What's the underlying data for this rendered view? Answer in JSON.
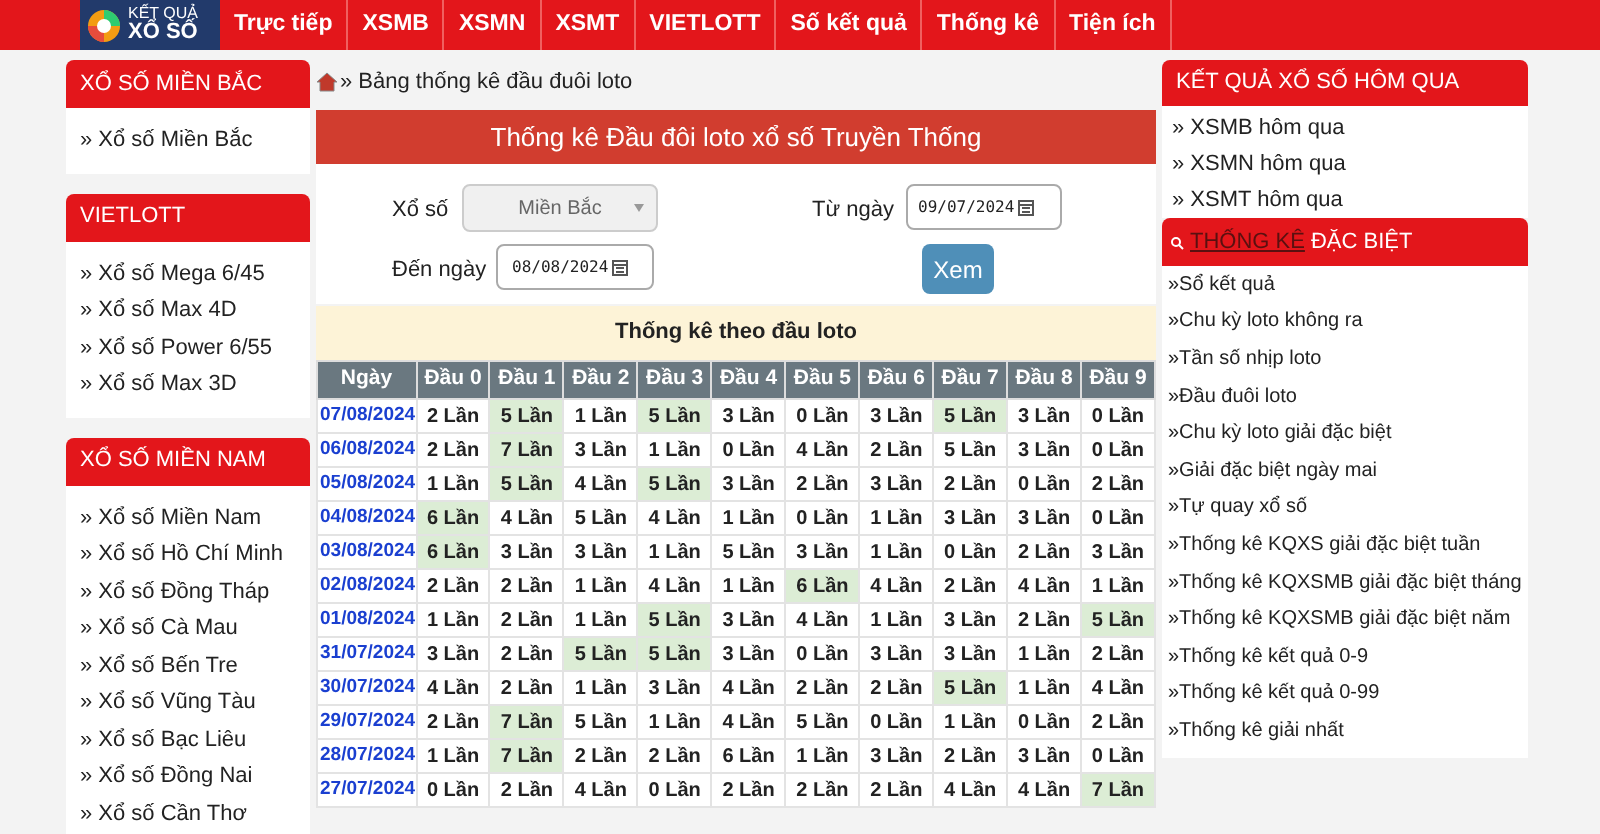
{
  "header": {
    "logo": {
      "line_1": "KẾT QUẢ",
      "line_2": "XỔ SỐ"
    },
    "nav": [
      "Trực tiếp",
      "XSMB",
      "XSMN",
      "XSMT",
      "VIETLOTT",
      "Số kết quả",
      "Thống kê",
      "Tiện ích"
    ]
  },
  "left_sidebar": [
    {
      "title": "XỔ SỐ MIỀN BẮC",
      "items": [
        "» Xổ số Miền Bắc"
      ]
    },
    {
      "title": "VIETLOTT",
      "items": [
        "» Xổ số Mega 6/45",
        "» Xổ số Max 4D",
        "» Xổ số Power 6/55",
        "» Xổ số Max 3D"
      ]
    },
    {
      "title": "XỔ SỐ MIỀN NAM",
      "items": [
        "» Xổ số Miền Nam",
        "» Xổ số Hồ Chí Minh",
        "» Xổ số Đồng Tháp",
        "» Xổ số Cà Mau",
        "» Xổ số Bến Tre",
        "» Xổ số Vũng Tàu",
        "» Xổ số Bạc Liêu",
        "» Xổ số Đồng Nai",
        "» Xổ số Cần Thơ"
      ]
    }
  ],
  "breadcrumb": "» Bảng thống kê đầu đuôi loto",
  "panel_title": "Thống kê Đầu đôi loto xổ số Truyền Thống",
  "form": {
    "lottery_label": "Xổ số",
    "lottery_value": "Miền Bắc",
    "from_label": "Từ ngày",
    "from_value": "09/07/2024",
    "to_label": "Đến ngày",
    "to_value": "08/08/2024",
    "submit": "Xem"
  },
  "table": {
    "caption": "Thống kê theo đầu loto",
    "date_column": "Ngày",
    "columns": [
      "Đầu 0",
      "Đầu 1",
      "Đầu 2",
      "Đầu 3",
      "Đầu 4",
      "Đầu 5",
      "Đầu 6",
      "Đầu 7",
      "Đầu 8",
      "Đầu 9"
    ],
    "rows": [
      {
        "date": "07/08/2024",
        "cells": [
          {
            "text": "2 Lần",
            "highlighted": false
          },
          {
            "text": "5 Lần",
            "highlighted": true
          },
          {
            "text": "1 Lần",
            "highlighted": false
          },
          {
            "text": "5 Lần",
            "highlighted": true
          },
          {
            "text": "3 Lần",
            "highlighted": false
          },
          {
            "text": "0 Lần",
            "highlighted": false
          },
          {
            "text": "3 Lần",
            "highlighted": false
          },
          {
            "text": "5 Lần",
            "highlighted": true
          },
          {
            "text": "3 Lần",
            "highlighted": false
          },
          {
            "text": "0 Lần",
            "highlighted": false
          }
        ]
      },
      {
        "date": "06/08/2024",
        "cells": [
          {
            "text": "2 Lần",
            "highlighted": false
          },
          {
            "text": "7 Lần",
            "highlighted": true
          },
          {
            "text": "3 Lần",
            "highlighted": false
          },
          {
            "text": "1 Lần",
            "highlighted": false
          },
          {
            "text": "0 Lần",
            "highlighted": false
          },
          {
            "text": "4 Lần",
            "highlighted": false
          },
          {
            "text": "2 Lần",
            "highlighted": false
          },
          {
            "text": "5 Lần",
            "highlighted": false
          },
          {
            "text": "3 Lần",
            "highlighted": false
          },
          {
            "text": "0 Lần",
            "highlighted": false
          }
        ]
      },
      {
        "date": "05/08/2024",
        "cells": [
          {
            "text": "1 Lần",
            "highlighted": false
          },
          {
            "text": "5 Lần",
            "highlighted": true
          },
          {
            "text": "4 Lần",
            "highlighted": false
          },
          {
            "text": "5 Lần",
            "highlighted": true
          },
          {
            "text": "3 Lần",
            "highlighted": false
          },
          {
            "text": "2 Lần",
            "highlighted": false
          },
          {
            "text": "3 Lần",
            "highlighted": false
          },
          {
            "text": "2 Lần",
            "highlighted": false
          },
          {
            "text": "0 Lần",
            "highlighted": false
          },
          {
            "text": "2 Lần",
            "highlighted": false
          }
        ]
      },
      {
        "date": "04/08/2024",
        "cells": [
          {
            "text": "6 Lần",
            "highlighted": true
          },
          {
            "text": "4 Lần",
            "highlighted": false
          },
          {
            "text": "5 Lần",
            "highlighted": false
          },
          {
            "text": "4 Lần",
            "highlighted": false
          },
          {
            "text": "1 Lần",
            "highlighted": false
          },
          {
            "text": "0 Lần",
            "highlighted": false
          },
          {
            "text": "1 Lần",
            "highlighted": false
          },
          {
            "text": "3 Lần",
            "highlighted": false
          },
          {
            "text": "3 Lần",
            "highlighted": false
          },
          {
            "text": "0 Lần",
            "highlighted": false
          }
        ]
      },
      {
        "date": "03/08/2024",
        "cells": [
          {
            "text": "6 Lần",
            "highlighted": true
          },
          {
            "text": "3 Lần",
            "highlighted": false
          },
          {
            "text": "3 Lần",
            "highlighted": false
          },
          {
            "text": "1 Lần",
            "highlighted": false
          },
          {
            "text": "5 Lần",
            "highlighted": false
          },
          {
            "text": "3 Lần",
            "highlighted": false
          },
          {
            "text": "1 Lần",
            "highlighted": false
          },
          {
            "text": "0 Lần",
            "highlighted": false
          },
          {
            "text": "2 Lần",
            "highlighted": false
          },
          {
            "text": "3 Lần",
            "highlighted": false
          }
        ]
      },
      {
        "date": "02/08/2024",
        "cells": [
          {
            "text": "2 Lần",
            "highlighted": false
          },
          {
            "text": "2 Lần",
            "highlighted": false
          },
          {
            "text": "1 Lần",
            "highlighted": false
          },
          {
            "text": "4 Lần",
            "highlighted": false
          },
          {
            "text": "1 Lần",
            "highlighted": false
          },
          {
            "text": "6 Lần",
            "highlighted": true
          },
          {
            "text": "4 Lần",
            "highlighted": false
          },
          {
            "text": "2 Lần",
            "highlighted": false
          },
          {
            "text": "4 Lần",
            "highlighted": false
          },
          {
            "text": "1 Lần",
            "highlighted": false
          }
        ]
      },
      {
        "date": "01/08/2024",
        "cells": [
          {
            "text": "1 Lần",
            "highlighted": false
          },
          {
            "text": "2 Lần",
            "highlighted": false
          },
          {
            "text": "1 Lần",
            "highlighted": false
          },
          {
            "text": "5 Lần",
            "highlighted": true
          },
          {
            "text": "3 Lần",
            "highlighted": false
          },
          {
            "text": "4 Lần",
            "highlighted": false
          },
          {
            "text": "1 Lần",
            "highlighted": false
          },
          {
            "text": "3 Lần",
            "highlighted": false
          },
          {
            "text": "2 Lần",
            "highlighted": false
          },
          {
            "text": "5 Lần",
            "highlighted": true
          }
        ]
      },
      {
        "date": "31/07/2024",
        "cells": [
          {
            "text": "3 Lần",
            "highlighted": false
          },
          {
            "text": "2 Lần",
            "highlighted": false
          },
          {
            "text": "5 Lần",
            "highlighted": true
          },
          {
            "text": "5 Lần",
            "highlighted": true
          },
          {
            "text": "3 Lần",
            "highlighted": false
          },
          {
            "text": "0 Lần",
            "highlighted": false
          },
          {
            "text": "3 Lần",
            "highlighted": false
          },
          {
            "text": "3 Lần",
            "highlighted": false
          },
          {
            "text": "1 Lần",
            "highlighted": false
          },
          {
            "text": "2 Lần",
            "highlighted": false
          }
        ]
      },
      {
        "date": "30/07/2024",
        "cells": [
          {
            "text": "4 Lần",
            "highlighted": false
          },
          {
            "text": "2 Lần",
            "highlighted": false
          },
          {
            "text": "1 Lần",
            "highlighted": false
          },
          {
            "text": "3 Lần",
            "highlighted": false
          },
          {
            "text": "4 Lần",
            "highlighted": false
          },
          {
            "text": "2 Lần",
            "highlighted": false
          },
          {
            "text": "2 Lần",
            "highlighted": false
          },
          {
            "text": "5 Lần",
            "highlighted": true
          },
          {
            "text": "1 Lần",
            "highlighted": false
          },
          {
            "text": "4 Lần",
            "highlighted": false
          }
        ]
      },
      {
        "date": "29/07/2024",
        "cells": [
          {
            "text": "2 Lần",
            "highlighted": false
          },
          {
            "text": "7 Lần",
            "highlighted": true
          },
          {
            "text": "5 Lần",
            "highlighted": false
          },
          {
            "text": "1 Lần",
            "highlighted": false
          },
          {
            "text": "4 Lần",
            "highlighted": false
          },
          {
            "text": "5 Lần",
            "highlighted": false
          },
          {
            "text": "0 Lần",
            "highlighted": false
          },
          {
            "text": "1 Lần",
            "highlighted": false
          },
          {
            "text": "0 Lần",
            "highlighted": false
          },
          {
            "text": "2 Lần",
            "highlighted": false
          }
        ]
      },
      {
        "date": "28/07/2024",
        "cells": [
          {
            "text": "1 Lần",
            "highlighted": false
          },
          {
            "text": "7 Lần",
            "highlighted": true
          },
          {
            "text": "2 Lần",
            "highlighted": false
          },
          {
            "text": "2 Lần",
            "highlighted": false
          },
          {
            "text": "6 Lần",
            "highlighted": false
          },
          {
            "text": "1 Lần",
            "highlighted": false
          },
          {
            "text": "3 Lần",
            "highlighted": false
          },
          {
            "text": "2 Lần",
            "highlighted": false
          },
          {
            "text": "3 Lần",
            "highlighted": false
          },
          {
            "text": "0 Lần",
            "highlighted": false
          }
        ]
      },
      {
        "date": "27/07/2024",
        "cells": [
          {
            "text": "0 Lần",
            "highlighted": false
          },
          {
            "text": "2 Lần",
            "highlighted": false
          },
          {
            "text": "4 Lần",
            "highlighted": false
          },
          {
            "text": "0 Lần",
            "highlighted": false
          },
          {
            "text": "2 Lần",
            "highlighted": false
          },
          {
            "text": "2 Lần",
            "highlighted": false
          },
          {
            "text": "2 Lần",
            "highlighted": false
          },
          {
            "text": "4 Lần",
            "highlighted": false
          },
          {
            "text": "4 Lần",
            "highlighted": false
          },
          {
            "text": "7 Lần",
            "highlighted": true
          }
        ]
      }
    ]
  },
  "right_sidebar": {
    "yesterday": {
      "title": "KẾT QUẢ XỔ SỐ HÔM QUA",
      "items": [
        "» XSMB hôm qua",
        "» XSMN hôm qua",
        "» XSMT hôm qua"
      ]
    },
    "special": {
      "title_link": "THỐNG KÊ",
      "title_rest": "ĐẶC BIỆT",
      "items": [
        "»Sổ kết quả",
        "»Chu kỳ loto không ra",
        "»Tần số nhịp loto",
        "»Đầu đuôi loto",
        "»Chu kỳ loto giải đặc biệt",
        "»Giải đặc biệt ngày mai",
        "»Tự quay xổ số",
        "»Thống kê KQXS giải đặc biệt tuần",
        "»Thống kê KQXSMB giải đặc biệt tháng",
        "»Thống kê KQXSMB giải đặc biệt năm",
        "»Thống kê kết quả 0-9",
        "»Thống kê kết quả 0-99",
        "»Thống kê giải nhất"
      ]
    }
  }
}
